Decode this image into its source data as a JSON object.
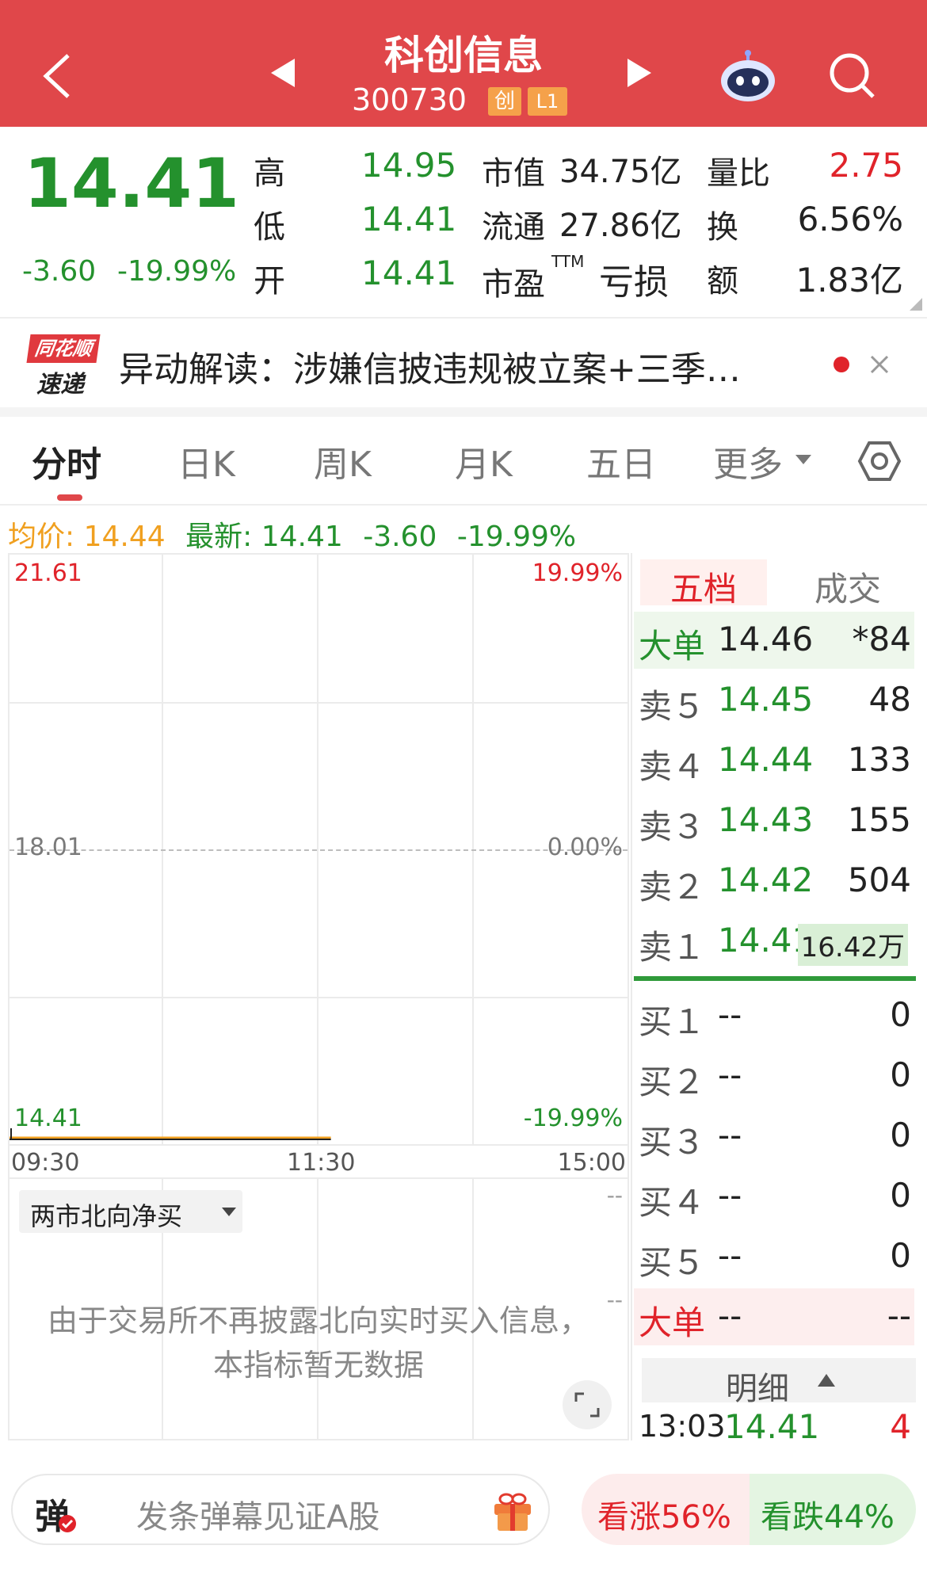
{
  "header": {
    "title": "科创信息",
    "code": "300730",
    "badge1": "创",
    "badge2": "L1"
  },
  "quote": {
    "price": "14.41",
    "change": "-3.60",
    "change_pct": "-19.99%",
    "high_label": "高",
    "high": "14.95",
    "low_label": "低",
    "low": "14.41",
    "open_label": "开",
    "open": "14.41",
    "mcap_label": "市值",
    "mcap": "34.75亿",
    "float_label": "流通",
    "float": "27.86亿",
    "pe_label": "市盈",
    "pe_sup": "TTM",
    "pe": "亏损",
    "vr_label": "量比",
    "vr": "2.75",
    "turnover_label": "换",
    "turnover": "6.56%",
    "amount_label": "额",
    "amount": "1.83亿"
  },
  "news": {
    "logo_top": "同花顺",
    "logo_bottom": "速递",
    "text": "异动解读：涉嫌信披违规被立案+三季…"
  },
  "tabs": [
    "分时",
    "日K",
    "周K",
    "月K",
    "五日",
    "更多"
  ],
  "chart_info": {
    "avg_label": "均价:",
    "avg": "14.44",
    "last_label": "最新:",
    "last": "14.41",
    "chg": "-3.60",
    "chg_pct": "-19.99%"
  },
  "chart_data": {
    "type": "line",
    "x_ticks": [
      "09:30",
      "11:30",
      "15:00"
    ],
    "ylim": [
      14.41,
      21.61
    ],
    "y_left_labels": [
      "21.61",
      "18.01",
      "14.41"
    ],
    "y_right_labels": [
      "19.99%",
      "0.00%",
      "-19.99%"
    ],
    "series": [
      {
        "name": "",
        "values": [
          14.41,
          14.41,
          14.41,
          14.41,
          14.41,
          14.41,
          14.41,
          14.41,
          14.41,
          14.41,
          14.41,
          14.41,
          14.41,
          14.41,
          14.41,
          14.41,
          14.41,
          14.41,
          14.41,
          14.41,
          14.41,
          14.41,
          14.41,
          14.41,
          14.41,
          14.41,
          14.41,
          14.41,
          14.41,
          14.41,
          14.41,
          14.41,
          14.41,
          14.41,
          14.41,
          14.41,
          14.41,
          14.41,
          14.41,
          14.41,
          14.41,
          14.41,
          14.41,
          14.41,
          14.41,
          14.41,
          14.41,
          14.41,
          14.41,
          14.41
        ]
      }
    ],
    "session_fraction": 0.52,
    "colors": {
      "line": "#222222",
      "avg": "#f0a020"
    }
  },
  "orderbook": {
    "tab_active": "五档",
    "tab_other": "成交",
    "big_sell": {
      "label": "大单",
      "price": "14.46",
      "vol": "*84"
    },
    "sells": [
      {
        "label": "卖５",
        "price": "14.45",
        "vol": "48"
      },
      {
        "label": "卖４",
        "price": "14.44",
        "vol": "133"
      },
      {
        "label": "卖３",
        "price": "14.43",
        "vol": "155"
      },
      {
        "label": "卖２",
        "price": "14.42",
        "vol": "504"
      },
      {
        "label": "卖１",
        "price": "14.41",
        "vol": "16.42万"
      }
    ],
    "buys": [
      {
        "label": "买１",
        "price": "--",
        "vol": "0"
      },
      {
        "label": "买２",
        "price": "--",
        "vol": "0"
      },
      {
        "label": "买３",
        "price": "--",
        "vol": "0"
      },
      {
        "label": "买４",
        "price": "--",
        "vol": "0"
      },
      {
        "label": "买５",
        "price": "--",
        "vol": "0"
      }
    ],
    "big_buy": {
      "label": "大单",
      "price": "--",
      "vol": "--"
    },
    "detail_label": "明细",
    "detail_row": {
      "time": "13:03",
      "price": "14.41",
      "vol": "4"
    }
  },
  "north": {
    "dropdown": "两市北向净买",
    "dash": "--",
    "msg1": "由于交易所不再披露北向实时买入信息，",
    "msg2": "本指标暂无数据"
  },
  "bottom": {
    "danmu_icon": "弹",
    "placeholder": "发条弹幕见证A股",
    "up": "看涨56%",
    "down": "看跌44%"
  }
}
